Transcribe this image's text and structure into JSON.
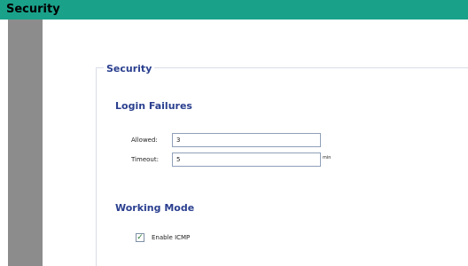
{
  "window": {
    "title": "Security"
  },
  "panel": {
    "title": "Security",
    "login_failures": {
      "heading": "Login Failures",
      "allowed_label": "Allowed:",
      "allowed_value": "3",
      "timeout_label": "Timeout:",
      "timeout_value": "5",
      "timeout_unit": "min"
    },
    "working_mode": {
      "heading": "Working Mode",
      "enable_icmp_label": "Enable ICMP",
      "enable_icmp_checked": true
    }
  },
  "colors": {
    "title_bar": "#1aa18a",
    "sidebar": "#8c8c8c",
    "heading_text": "#2a3f8f"
  },
  "icons": {
    "checkbox_check": "check-icon"
  }
}
